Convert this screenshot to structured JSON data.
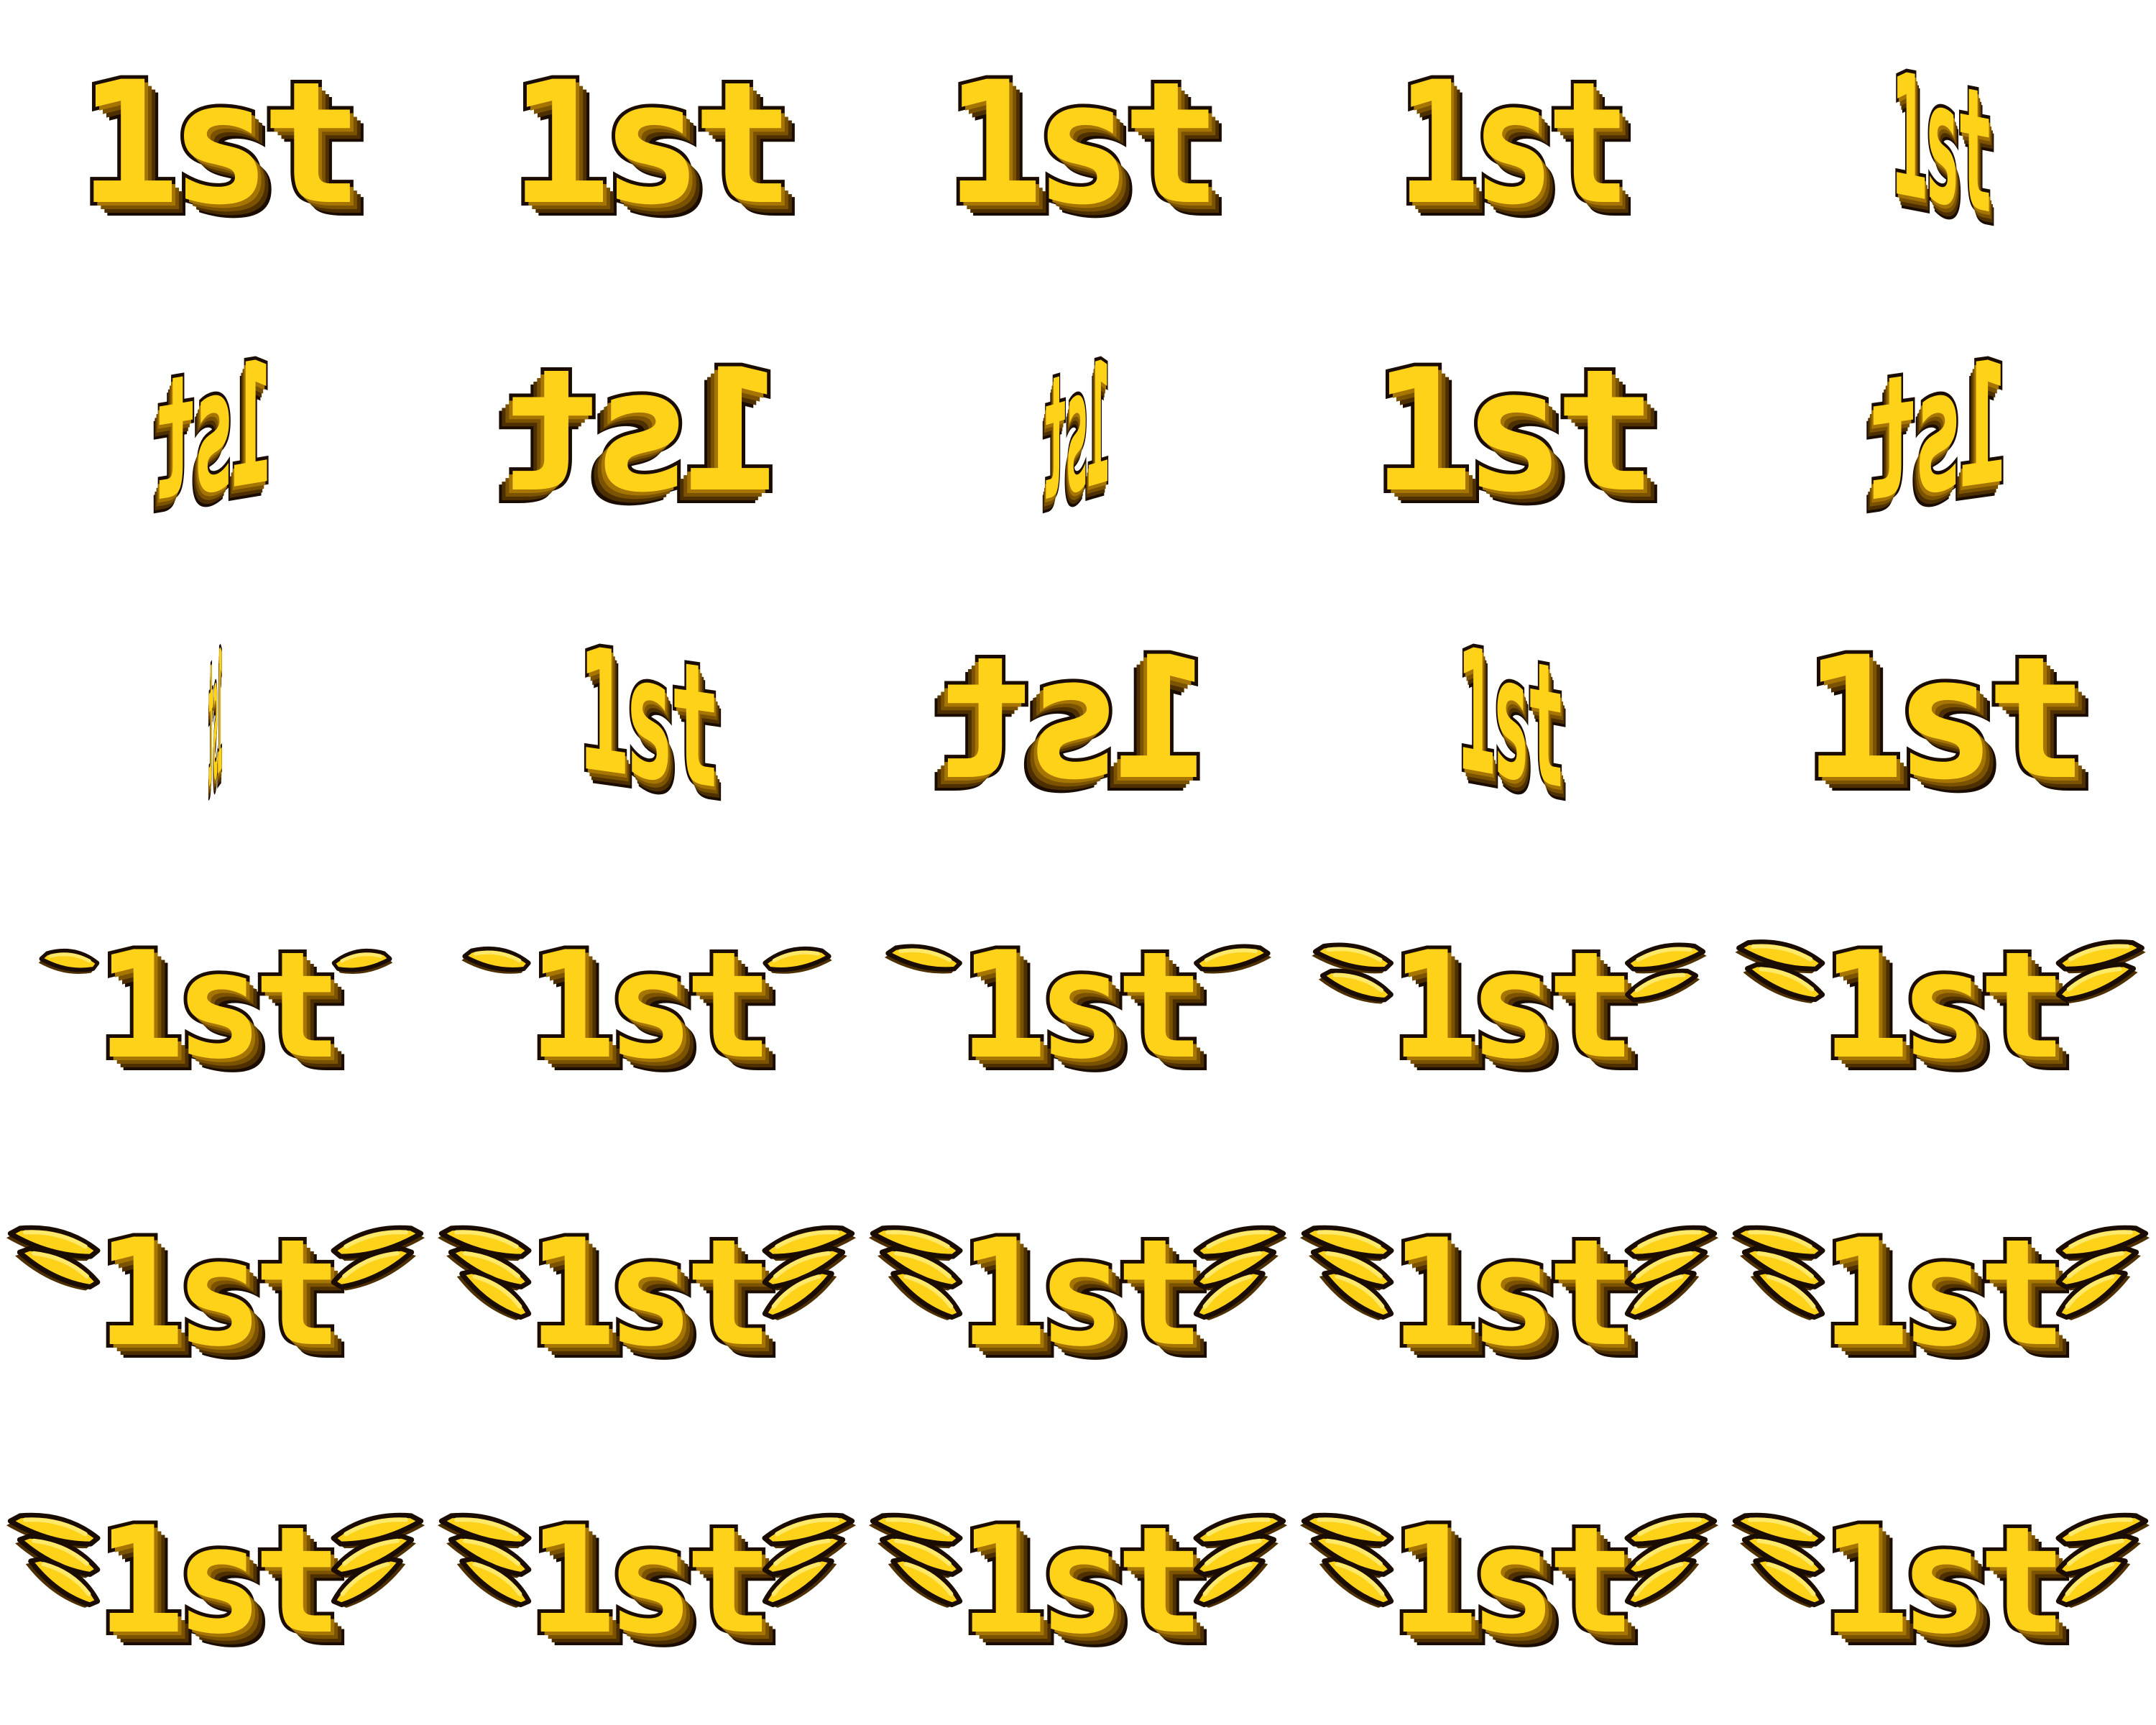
{
  "sprite_sheet": {
    "badge_text": "1st",
    "colors": {
      "gold": "#ffd21a",
      "gold_light": "#ffe96a",
      "gold_mid": "#e8aa00",
      "gold_dark": "#a57500",
      "brown_shadow": "#4e3000",
      "outline": "#1a0c00",
      "background": "#ffffff"
    },
    "rows": [
      {
        "name": "flip-row-1",
        "frames": [
          {
            "icon": "1st-badge",
            "wings": 0,
            "flip": "normal",
            "squash": 1.0
          },
          {
            "icon": "1st-badge",
            "wings": 0,
            "flip": "normal",
            "squash": 1.0
          },
          {
            "icon": "1st-badge",
            "wings": 0,
            "flip": "normal",
            "squash": 0.97
          },
          {
            "icon": "1st-badge",
            "wings": 0,
            "flip": "normal",
            "squash": 0.82
          },
          {
            "icon": "1st-badge",
            "wings": 0,
            "flip": "normal",
            "squash": 0.36
          }
        ]
      },
      {
        "name": "flip-row-2",
        "frames": [
          {
            "icon": "1st-badge",
            "wings": 0,
            "flip": "mirrored",
            "squash": 0.42
          },
          {
            "icon": "1st-badge",
            "wings": 0,
            "flip": "mirrored",
            "squash": 1.0
          },
          {
            "icon": "1st-badge",
            "wings": 0,
            "flip": "mirrored",
            "squash": 0.24
          },
          {
            "icon": "1st-badge",
            "wings": 0,
            "flip": "normal",
            "squash": 1.0
          },
          {
            "icon": "1st-badge",
            "wings": 0,
            "flip": "mirrored",
            "squash": 0.5
          }
        ]
      },
      {
        "name": "flip-row-3",
        "frames": [
          {
            "icon": "1st-badge",
            "wings": 0,
            "flip": "mirrored",
            "squash": 0.05
          },
          {
            "icon": "1st-badge",
            "wings": 0,
            "flip": "normal",
            "squash": 0.5
          },
          {
            "icon": "1st-badge",
            "wings": 0,
            "flip": "mirrored",
            "squash": 0.97
          },
          {
            "icon": "1st-badge",
            "wings": 0,
            "flip": "normal",
            "squash": 0.38
          },
          {
            "icon": "1st-badge",
            "wings": 0,
            "flip": "normal",
            "squash": 1.0
          }
        ]
      },
      {
        "name": "wings-row-1",
        "frames": [
          {
            "icon": "1st-badge-winged",
            "wings": 1,
            "spread": 0.2
          },
          {
            "icon": "1st-badge-winged",
            "wings": 1,
            "spread": 0.4
          },
          {
            "icon": "1st-badge-winged",
            "wings": 1,
            "spread": 0.6
          },
          {
            "icon": "1st-badge-winged",
            "wings": 2,
            "spread": 0.7
          },
          {
            "icon": "1st-badge-winged",
            "wings": 2,
            "spread": 0.9
          }
        ]
      },
      {
        "name": "wings-row-2",
        "frames": [
          {
            "icon": "1st-badge-winged",
            "wings": 2,
            "spread": 1.0
          },
          {
            "icon": "1st-badge-winged",
            "wings": 3,
            "spread": 1.0
          },
          {
            "icon": "1st-badge-winged",
            "wings": 3,
            "spread": 1.0
          },
          {
            "icon": "1st-badge-winged",
            "wings": 3,
            "spread": 1.0
          },
          {
            "icon": "1st-badge-winged",
            "wings": 3,
            "spread": 1.0
          }
        ]
      },
      {
        "name": "wings-row-3",
        "frames": [
          {
            "icon": "1st-badge-winged",
            "wings": 3,
            "spread": 1.0
          },
          {
            "icon": "1st-badge-winged",
            "wings": 3,
            "spread": 1.0
          },
          {
            "icon": "1st-badge-winged",
            "wings": 3,
            "spread": 1.0
          },
          {
            "icon": "1st-badge-winged",
            "wings": 3,
            "spread": 1.0
          },
          {
            "icon": "1st-badge-winged",
            "wings": 3,
            "spread": 1.0
          }
        ]
      }
    ]
  }
}
